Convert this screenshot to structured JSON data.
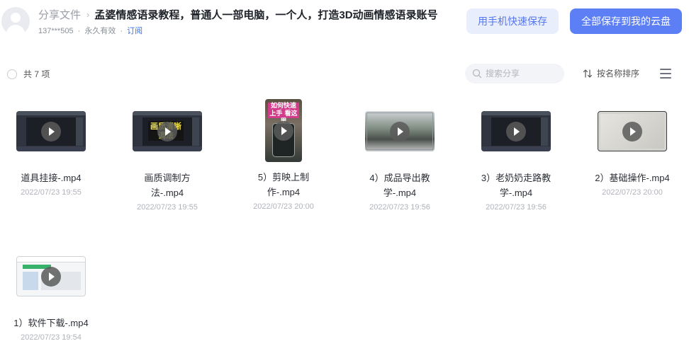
{
  "header": {
    "breadcrumb_root": "分享文件",
    "breadcrumb_sep": "›",
    "title": "孟婆情感语录教程，普通人一部电脑，一个人，打造3D动画情感语录账号",
    "sharer": "137***505",
    "meta_dot": "·",
    "validity": "永久有效",
    "subscribe": "订阅",
    "btn_mobile": "用手机快速保存",
    "btn_save_all": "全部保存到我的云盘"
  },
  "toolbar": {
    "count_label": "共 7 项",
    "search_placeholder": "搜索分享",
    "sort_label": "按名称排序"
  },
  "files": [
    {
      "name": "道具挂接-.mp4",
      "date": "2022/07/23 19:55",
      "thumb": "dark-editor"
    },
    {
      "name": "画质调制方法-.mp4",
      "date": "2022/07/23 19:55",
      "thumb": "dark-editor-yellow-text",
      "thumb_text": "画质清晰调法"
    },
    {
      "name": "5）剪映上制作-.mp4",
      "date": "2022/07/23 20:00",
      "thumb": "phone-portrait",
      "thumb_text": "如何快速上手 看这里"
    },
    {
      "name": "4）成品导出教学-.mp4",
      "date": "2022/07/23 19:56",
      "thumb": "photo-frame"
    },
    {
      "name": "3）老奶奶走路教学-.mp4",
      "date": "2022/07/23 19:56",
      "thumb": "dark-editor"
    },
    {
      "name": "2）基础操作-.mp4",
      "date": "2022/07/23 20:00",
      "thumb": "grey-screen"
    },
    {
      "name": "1）软件下载-.mp4",
      "date": "2022/07/23 19:54",
      "thumb": "web-page"
    }
  ],
  "colors": {
    "accent": "#5d7ff5",
    "accent_light_bg": "#e9eefc",
    "link": "#3a70e8"
  }
}
